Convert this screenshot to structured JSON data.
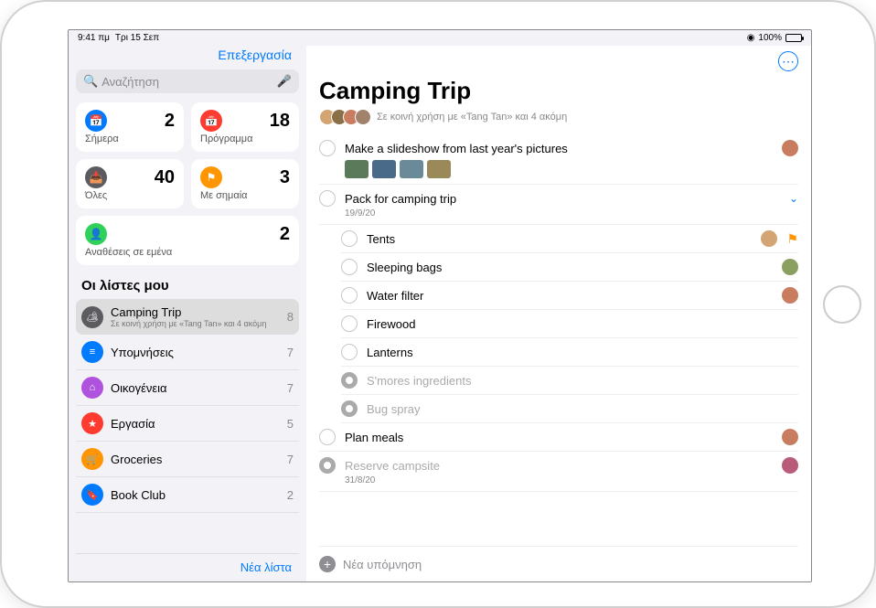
{
  "statusbar": {
    "time": "9:41 πμ",
    "date": "Τρι 15 Σεπ",
    "battery": "100%"
  },
  "sidebar": {
    "edit": "Επεξεργασία",
    "search_placeholder": "Αναζήτηση",
    "cards": {
      "today": {
        "label": "Σήμερα",
        "count": "2",
        "color": "#007aff",
        "icon": "📅"
      },
      "scheduled": {
        "label": "Πρόγραμμα",
        "count": "18",
        "color": "#ff3b30",
        "icon": "📅"
      },
      "all": {
        "label": "Όλες",
        "count": "40",
        "color": "#5b5b60",
        "icon": "📥"
      },
      "flagged": {
        "label": "Με σημαία",
        "count": "3",
        "color": "#ff9500",
        "icon": "⚑"
      },
      "assigned": {
        "label": "Αναθέσεις σε εμένα",
        "count": "2",
        "color": "#30d158",
        "icon": "👤"
      }
    },
    "my_lists_header": "Οι λίστες μου",
    "lists": [
      {
        "name": "Camping Trip",
        "sub": "Σε κοινή χρήση με «Tang Tan» και 4 ακόμη",
        "count": "8",
        "color": "#5b5b60",
        "icon": "🏕",
        "selected": true
      },
      {
        "name": "Υπομνήσεις",
        "count": "7",
        "color": "#007aff",
        "icon": "≡"
      },
      {
        "name": "Οικογένεια",
        "count": "7",
        "color": "#af52de",
        "icon": "⌂"
      },
      {
        "name": "Εργασία",
        "count": "5",
        "color": "#ff3b30",
        "icon": "★"
      },
      {
        "name": "Groceries",
        "count": "7",
        "color": "#ff9500",
        "icon": "🛒"
      },
      {
        "name": "Book Club",
        "count": "2",
        "color": "#007aff",
        "icon": "🔖"
      }
    ],
    "new_list": "Νέα λίστα"
  },
  "main": {
    "title": "Camping Trip",
    "shared_text": "Σε κοινή χρήση με «Tang Tan» και 4 ακόμη",
    "avatars": [
      "#d4a574",
      "#8b6f47",
      "#c97d60",
      "#a0826d"
    ],
    "reminders": [
      {
        "title": "Make a slideshow from last year's pictures",
        "avatar": "#c97d60",
        "thumbs": [
          "#5a7a5a",
          "#4a6a8a",
          "#6a8a9a",
          "#9a8a5a"
        ]
      },
      {
        "title": "Pack for camping trip",
        "date": "19/9/20",
        "expand": true,
        "sub": [
          {
            "title": "Tents",
            "avatar": "#d4a574",
            "flag": true
          },
          {
            "title": "Sleeping bags",
            "avatar": "#8b9f60"
          },
          {
            "title": "Water filter",
            "avatar": "#c97d60"
          },
          {
            "title": "Firewood"
          },
          {
            "title": "Lanterns"
          },
          {
            "title": "S'mores ingredients",
            "done": true
          },
          {
            "title": "Bug spray",
            "done": true
          }
        ]
      },
      {
        "title": "Plan meals",
        "avatar": "#c97d60"
      },
      {
        "title": "Reserve campsite",
        "date": "31/8/20",
        "done": true,
        "avatar": "#b85c7a"
      }
    ],
    "new_reminder": "Νέα υπόμνηση"
  }
}
